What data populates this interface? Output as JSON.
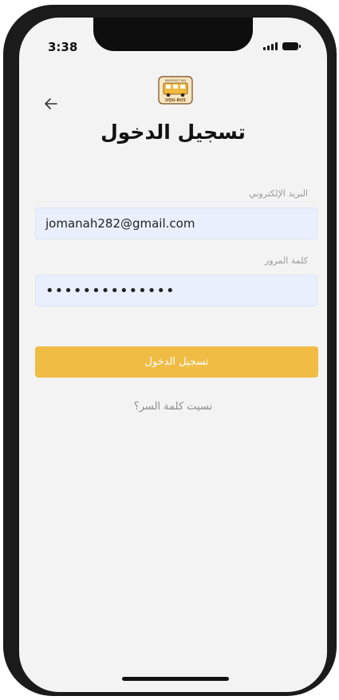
{
  "status_bar": {
    "time": "3:38"
  },
  "header": {
    "title": "تسجيل الدخول"
  },
  "logo": {
    "top_text": "UNIVERSITY BUS",
    "bottom_text": "UQU-BUS"
  },
  "form": {
    "email_label": "البريد الإلكتروني",
    "email_value": "jomanah282@gmail.com",
    "password_label": "كلمة المرور",
    "password_value": "••••••••••••••",
    "submit_label": "تسجيل الدخول",
    "forgot_label": "نسيت كلمة السر؟"
  },
  "colors": {
    "accent": "#f0bc44",
    "input_bg": "#e9effc",
    "screen_bg": "#f3f3f3"
  }
}
